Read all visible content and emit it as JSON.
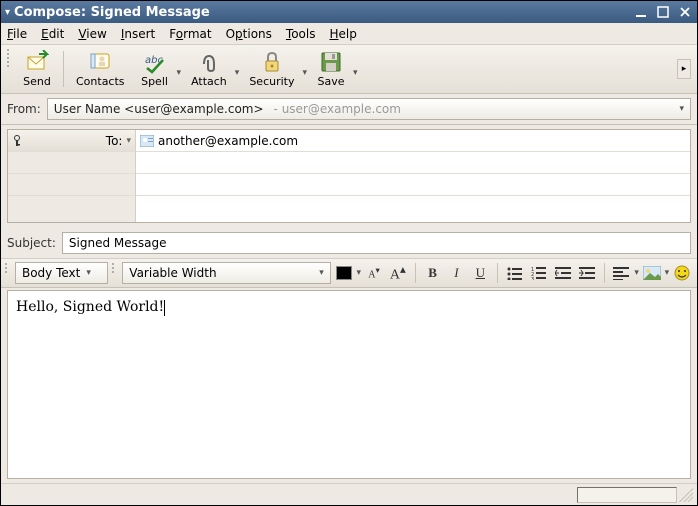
{
  "window": {
    "title": "Compose: Signed Message"
  },
  "menu": {
    "file": "File",
    "edit": "Edit",
    "view": "View",
    "insert": "Insert",
    "format": "Format",
    "options": "Options",
    "tools": "Tools",
    "help": "Help"
  },
  "toolbar": {
    "send": "Send",
    "contacts": "Contacts",
    "spell": "Spell",
    "attach": "Attach",
    "security": "Security",
    "save": "Save"
  },
  "from": {
    "label": "From:",
    "value": "User Name <user@example.com>",
    "hint": "- user@example.com"
  },
  "recipients": {
    "to_label": "To:",
    "to_value": "another@example.com"
  },
  "subject": {
    "label": "Subject:",
    "value": "Signed Message"
  },
  "format": {
    "para": "Body Text",
    "font": "Variable Width"
  },
  "body": "Hello, Signed World!",
  "icons": {
    "send": "send",
    "contacts": "contacts",
    "spell": "spell",
    "attach": "attach",
    "security": "security",
    "save": "save",
    "color": "#000000"
  }
}
